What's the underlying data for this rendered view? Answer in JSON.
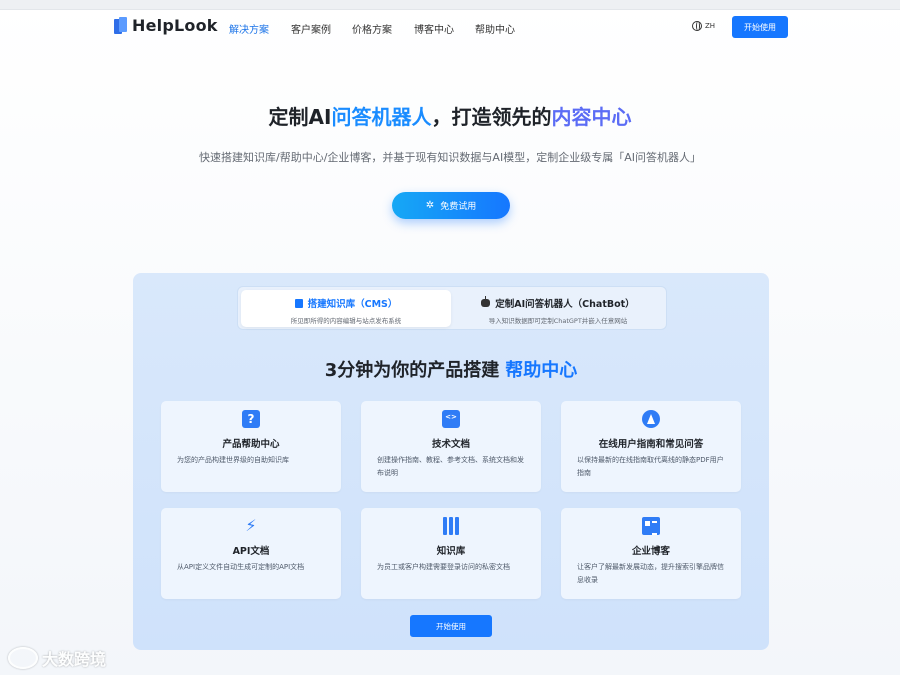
{
  "nav": {
    "logo": "HelpLook",
    "items": [
      "解决方案",
      "客户案例",
      "价格方案",
      "博客中心",
      "帮助中心"
    ],
    "active_index": 0,
    "lang": "ZH",
    "start_button": "开始使用"
  },
  "hero": {
    "title_part1": "定制AI",
    "title_part2": "问答机器人",
    "title_part3": "，打造领先的",
    "title_part4": "内容中心",
    "subtitle": "快速搭建知识库/帮助中心/企业博客，并基于现有知识数据与AI模型，定制企业级专属「AI问答机器人」",
    "trial_button": "免费试用"
  },
  "tabs": [
    {
      "title": "搭建知识库（CMS）",
      "desc": "所见即所得的内容编辑与站点发布系统"
    },
    {
      "title": "定制AI问答机器人（ChatBot）",
      "desc": "导入知识数据即可定制ChatGPT并嵌入任意网站"
    }
  ],
  "panel": {
    "heading_part1": "3分钟为你的产品搭建",
    "heading_part2": "帮助中心",
    "button": "开始使用"
  },
  "cards": [
    {
      "icon": "question-icon",
      "title": "产品帮助中心",
      "desc": "为您的产品构建世界级的自助知识库"
    },
    {
      "icon": "code-folder-icon",
      "title": "技术文档",
      "desc": "创建操作指南、教程、参考文档、系统文档和发布说明"
    },
    {
      "icon": "navigation-icon",
      "title": "在线用户指南和常见问答",
      "desc": "以保持最新的在线指南取代离线的静态PDF用户指南"
    },
    {
      "icon": "plug-icon",
      "title": "API文档",
      "desc": "从API定义文件自动生成可定制的API文档"
    },
    {
      "icon": "books-icon",
      "title": "知识库",
      "desc": "为员工或客户构建需要登录访问的私密文档"
    },
    {
      "icon": "blog-icon",
      "title": "企业博客",
      "desc": "让客户了解最新发展动态，提升搜索引擎品牌信息收录"
    }
  ],
  "watermark": "大数跨境"
}
